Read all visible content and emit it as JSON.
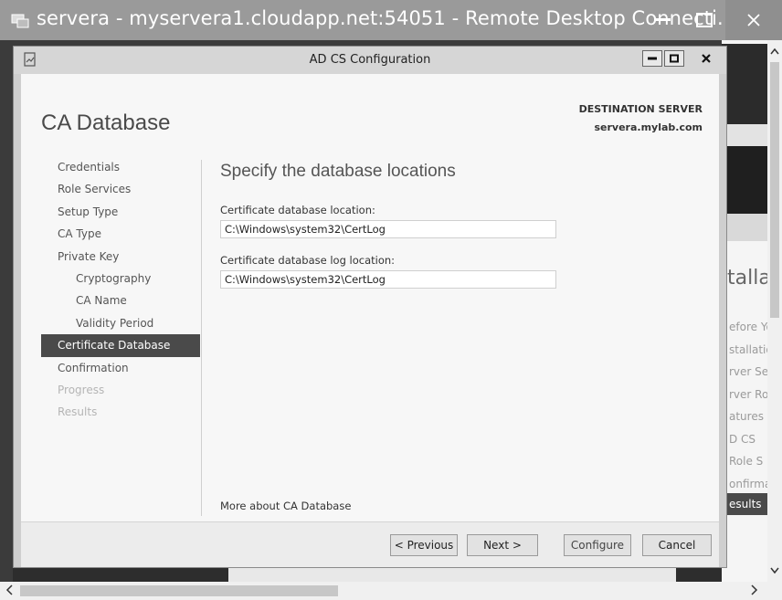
{
  "rdp": {
    "title": "servera - myservera1.cloudapp.net:54051 - Remote Desktop Connecti..."
  },
  "background": {
    "heading_fragment": "talla",
    "list_fragments": [
      "efore Yo",
      "stallatio",
      "rver Se",
      "rver Ro",
      "atures",
      "D CS",
      "Role S",
      "onfirma"
    ],
    "selected_fragment": "esults"
  },
  "dialog": {
    "title": "AD CS Configuration",
    "page_heading": "CA Database",
    "destination_label": "DESTINATION SERVER",
    "destination_server": "servera.mylab.com",
    "nav": [
      {
        "label": "Credentials",
        "state": "normal",
        "level": 0
      },
      {
        "label": "Role Services",
        "state": "normal",
        "level": 0
      },
      {
        "label": "Setup Type",
        "state": "normal",
        "level": 0
      },
      {
        "label": "CA Type",
        "state": "normal",
        "level": 0
      },
      {
        "label": "Private Key",
        "state": "normal",
        "level": 0
      },
      {
        "label": "Cryptography",
        "state": "normal",
        "level": 1
      },
      {
        "label": "CA Name",
        "state": "normal",
        "level": 1
      },
      {
        "label": "Validity Period",
        "state": "normal",
        "level": 1
      },
      {
        "label": "Certificate Database",
        "state": "active",
        "level": 0
      },
      {
        "label": "Confirmation",
        "state": "normal",
        "level": 0
      },
      {
        "label": "Progress",
        "state": "disabled",
        "level": 0
      },
      {
        "label": "Results",
        "state": "disabled",
        "level": 0
      }
    ],
    "content": {
      "title": "Specify the database locations",
      "db_location_label": "Certificate database location:",
      "db_location_value": "C:\\Windows\\system32\\CertLog",
      "log_location_label": "Certificate database log location:",
      "log_location_value": "C:\\Windows\\system32\\CertLog",
      "more_link": "More about CA Database"
    },
    "buttons": {
      "previous": "< Previous",
      "next": "Next >",
      "configure": "Configure",
      "cancel": "Cancel"
    }
  },
  "colors": {
    "active_nav_bg": "#4a4a4a",
    "rdp_titlebar": "#9a9a9a"
  }
}
